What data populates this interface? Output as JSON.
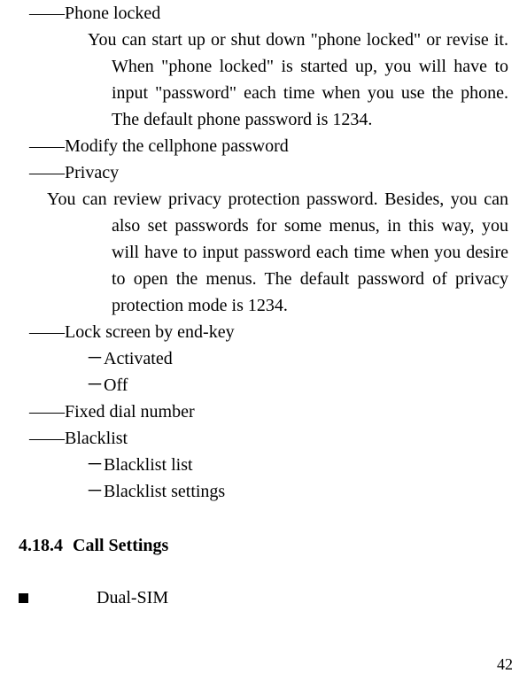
{
  "items": {
    "phone_locked": {
      "heading": "――Phone locked",
      "body": "You can start up or shut down \"phone locked\" or revise it. When \"phone locked\" is started up, you will have to input \"password\" each time when you use the phone. The default phone password is 1234."
    },
    "modify_pw": {
      "heading": "――Modify the cellphone password"
    },
    "privacy": {
      "heading": "――Privacy",
      "body": "You can review privacy protection password. Besides, you can also set passwords for some menus, in this way, you will have to input password each time when you desire to open the menus. The default password of privacy protection mode is 1234."
    },
    "lock_screen": {
      "heading": "――Lock screen by end-key",
      "opt1": "－Activated",
      "opt2": "－Off"
    },
    "fixed_dial": {
      "heading": "――Fixed dial number"
    },
    "blacklist": {
      "heading": "――Blacklist",
      "opt1": "－Blacklist list",
      "opt2": "－Blacklist settings"
    }
  },
  "section": {
    "number": "4.18.4",
    "title": "Call Settings"
  },
  "bullets": {
    "dual_sim": "Dual-SIM"
  },
  "page_number": "42"
}
